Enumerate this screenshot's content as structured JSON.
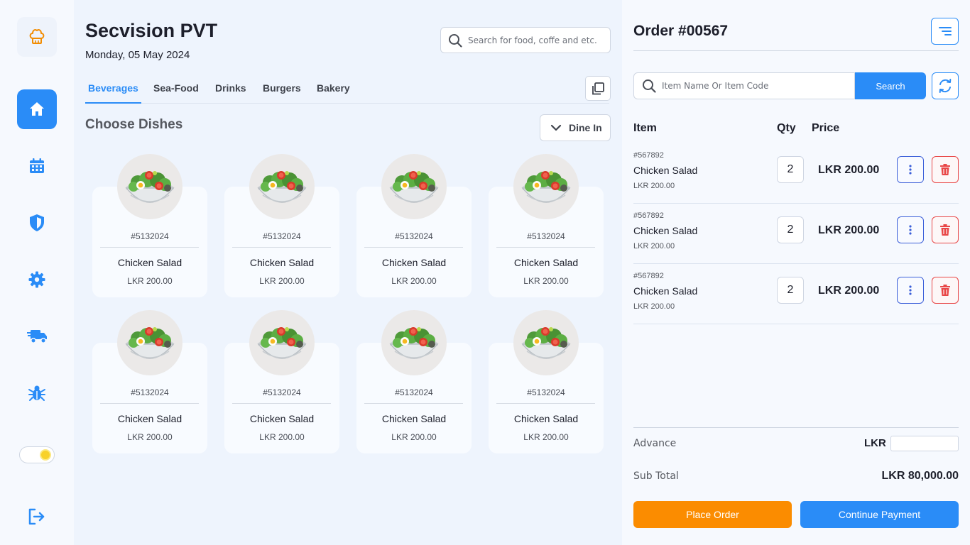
{
  "colors": {
    "accent": "#2a8cf7",
    "orange": "#fb8c00",
    "danger": "#e84747",
    "indigo": "#3b5fd9"
  },
  "sidebar": {
    "logo_icon": "chef-hat-icon",
    "items": [
      {
        "icon": "home-icon",
        "active": true
      },
      {
        "icon": "calendar-icon",
        "active": false
      },
      {
        "icon": "shield-icon",
        "active": false
      },
      {
        "icon": "gear-icon",
        "active": false
      },
      {
        "icon": "delivery-truck-icon",
        "active": false
      },
      {
        "icon": "bug-icon",
        "active": false
      }
    ],
    "theme_toggle_icon": "sun-icon",
    "logout_icon": "logout-icon"
  },
  "header": {
    "company": "Secvision PVT",
    "date": "Monday, 05 May 2024",
    "search_placeholder": "Search for food, coffe and etc."
  },
  "tabs": [
    {
      "label": "Beverages",
      "active": true
    },
    {
      "label": "Sea-Food",
      "active": false
    },
    {
      "label": "Drinks",
      "active": false
    },
    {
      "label": "Burgers",
      "active": false
    },
    {
      "label": "Bakery",
      "active": false
    }
  ],
  "menu": {
    "title": "Choose Dishes",
    "dine_option": "Dine In",
    "dishes": [
      {
        "code": "#5132024",
        "name": "Chicken Salad",
        "price": "LKR 200.00"
      },
      {
        "code": "#5132024",
        "name": "Chicken Salad",
        "price": "LKR 200.00"
      },
      {
        "code": "#5132024",
        "name": "Chicken Salad",
        "price": "LKR 200.00"
      },
      {
        "code": "#5132024",
        "name": "Chicken Salad",
        "price": "LKR 200.00"
      },
      {
        "code": "#5132024",
        "name": "Chicken Salad",
        "price": "LKR 200.00"
      },
      {
        "code": "#5132024",
        "name": "Chicken Salad",
        "price": "LKR 200.00"
      },
      {
        "code": "#5132024",
        "name": "Chicken Salad",
        "price": "LKR 200.00"
      },
      {
        "code": "#5132024",
        "name": "Chicken Salad",
        "price": "LKR 200.00"
      }
    ]
  },
  "order": {
    "title": "Order #00567",
    "search_placeholder": "Item Name Or Item Code",
    "search_label": "Search",
    "columns": {
      "item": "Item",
      "qty": "Qty",
      "price": "Price"
    },
    "items": [
      {
        "code": "#567892",
        "name": "Chicken Salad",
        "unit_price": "LKR 200.00",
        "qty": "2",
        "price": "LKR 200.00"
      },
      {
        "code": "#567892",
        "name": "Chicken Salad",
        "unit_price": "LKR 200.00",
        "qty": "2",
        "price": "LKR 200.00"
      },
      {
        "code": "#567892",
        "name": "Chicken Salad",
        "unit_price": "LKR 200.00",
        "qty": "2",
        "price": "LKR 200.00"
      }
    ],
    "advance_label": "Advance",
    "advance_currency": "LKR",
    "advance_value": "",
    "subtotal_label": "Sub Total",
    "subtotal_value": "LKR 80,000.00",
    "place_order_label": "Place Order",
    "continue_payment_label": "Continue Payment"
  }
}
